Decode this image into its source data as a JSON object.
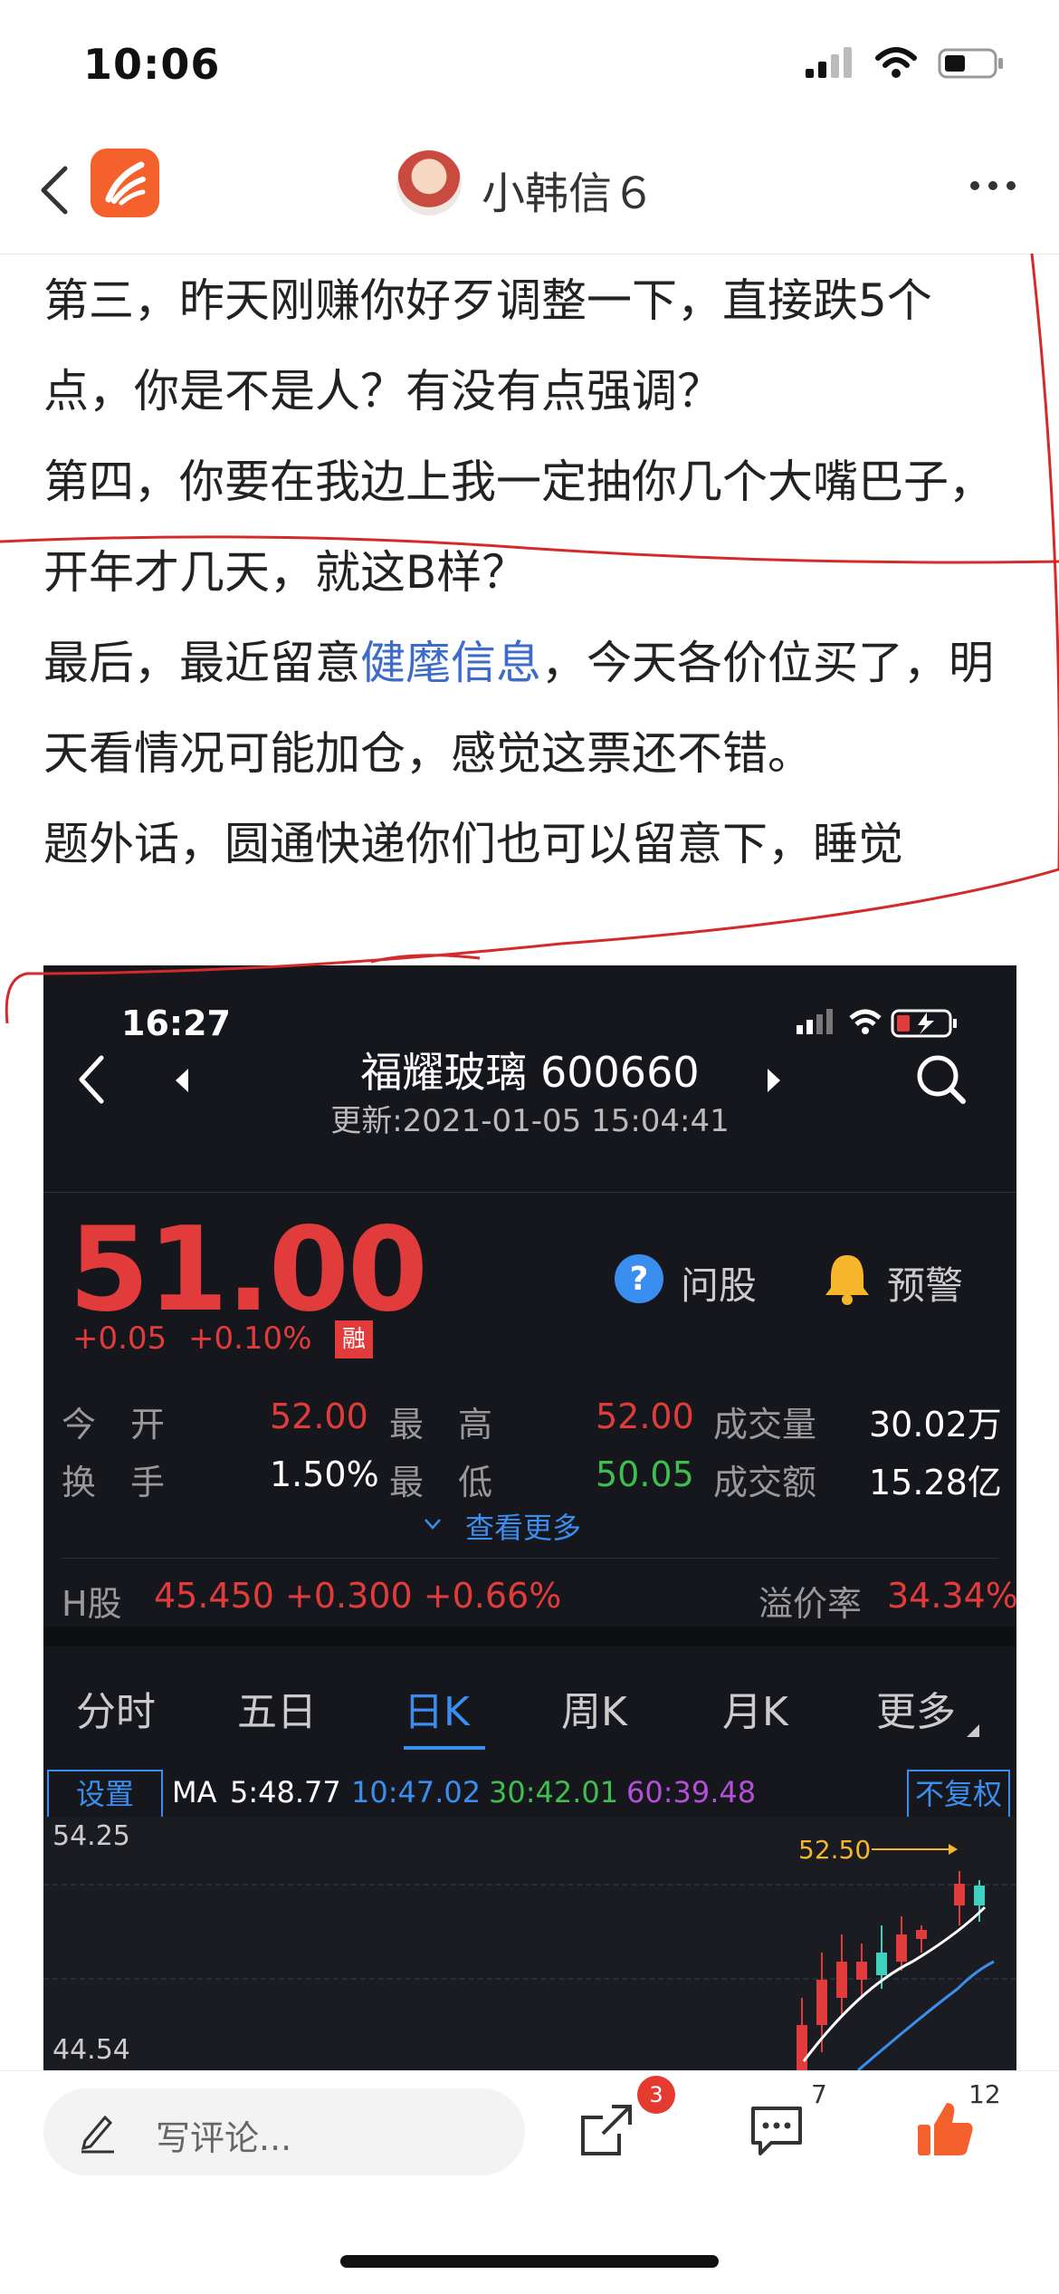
{
  "status_bar": {
    "time": "10:06"
  },
  "header": {
    "nickname": "小韩信６"
  },
  "article": {
    "p1": "第三，昨天刚赚你好歹调整一下，直接跌5个点，你是不是人？有没有点强调？",
    "p2": "第四，你要在我边上我一定抽你几个大嘴巴子，开年才几天，就这B样？",
    "p3_before": "最后，最近留意",
    "p3_link": "健麾信息",
    "p3_after": "，今天各价位买了，明天看情况可能加仓，感觉这票还不错。",
    "p4": "题外话，圆通快递你们也可以留意下，睡觉"
  },
  "embedded": {
    "time": "16:27",
    "stock_title": "福耀玻璃 600660",
    "updated": "更新:2021-01-05 15:04:41",
    "price": "51.00",
    "change": "+0.05",
    "change_pct": "+0.10%",
    "rong": "融",
    "ask_label": "问股",
    "alert_label": "预警",
    "stats": [
      {
        "label": "今　开",
        "value": "52.00",
        "color": "#e23b3b"
      },
      {
        "label": "最　高",
        "value": "52.00",
        "color": "#e23b3b"
      },
      {
        "label": "成交量",
        "value": "30.02万",
        "color": "#ffffff"
      },
      {
        "label": "换　手",
        "value": "1.50%",
        "color": "#ffffff"
      },
      {
        "label": "最　低",
        "value": "50.05",
        "color": "#3fbf4f"
      },
      {
        "label": "成交额",
        "value": "15.28亿",
        "color": "#ffffff"
      }
    ],
    "see_more": "查看更多",
    "h_label": "H股",
    "h_value": "45.450 +0.300 +0.66%",
    "premium_label": "溢价率",
    "premium_value": "34.34%",
    "tabs": [
      "分时",
      "五日",
      "日K",
      "周K",
      "月K",
      "更多"
    ],
    "active_tab": "日K",
    "settings": "设置",
    "ma_label": "MA",
    "ma5": "5:48.77",
    "ma10": "10:47.02",
    "ma30": "30:42.01",
    "ma60": "60:39.48",
    "fuquan": "不复权",
    "chart_data": {
      "type": "candlestick",
      "y_top_label": "54.25",
      "y_bottom_label": "44.54",
      "annotation": "52.50",
      "ylim": [
        44.54,
        54.25
      ]
    }
  },
  "bottom_bar": {
    "comment_placeholder": "写评论...",
    "share_badge": "3",
    "comment_count": "7",
    "like_count": "12"
  }
}
